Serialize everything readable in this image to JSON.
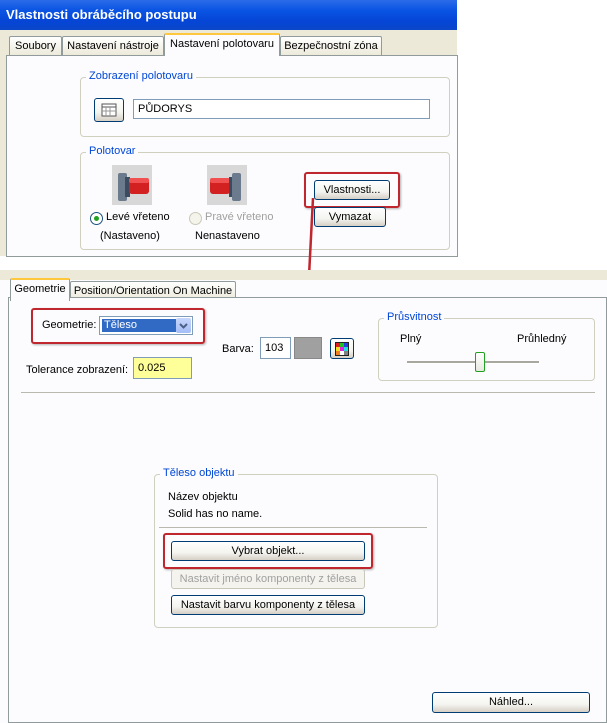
{
  "dialog": {
    "title": "Vlastnosti obráběcího postupu",
    "tabs": [
      "Soubory",
      "Nastavení nástroje",
      "Nastavení polotovaru",
      "Bezpečnostní zóna"
    ],
    "active_tab": "Nastavení polotovaru"
  },
  "stock_display": {
    "group_title": "Zobrazení polotovaru",
    "value": "PŮDORYS"
  },
  "stock": {
    "group_title": "Polotovar",
    "left_spindle_label": "Levé vřeteno",
    "left_spindle_status": "(Nastaveno)",
    "right_spindle_label": "Pravé vřeteno",
    "right_spindle_status": "Nenastaveno",
    "properties_button": "Vlastnosti...",
    "delete_button": "Vymazat"
  },
  "geometry_panel": {
    "tabs": [
      "Geometrie",
      "Position/Orientation On Machine"
    ],
    "active_tab": "Geometrie",
    "geometry_label": "Geometrie:",
    "geometry_value": "Těleso",
    "color_label": "Barva:",
    "color_value": "103",
    "tolerance_label": "Tolerance zobrazení:",
    "tolerance_value": "0.025",
    "transparency": {
      "title": "Průsvitnost",
      "min_label": "Plný",
      "max_label": "Průhledný",
      "level_percent": 55
    },
    "body": {
      "title": "Těleso objektu",
      "name_header": "Název objektu",
      "name_value": "Solid has no name.",
      "select_button": "Vybrat objekt...",
      "set_name_button": "Nastavit jméno komponenty z tělesa",
      "set_color_button": "Nastavit barvu komponenty z tělesa"
    },
    "preview_button": "Náhled..."
  },
  "colors": {
    "highlight": "#c0262d",
    "xp_title": "#0a54e3",
    "group_title": "#0046d5",
    "tolerance_bg": "#ffff99",
    "swatch": "#a0a0a0"
  }
}
